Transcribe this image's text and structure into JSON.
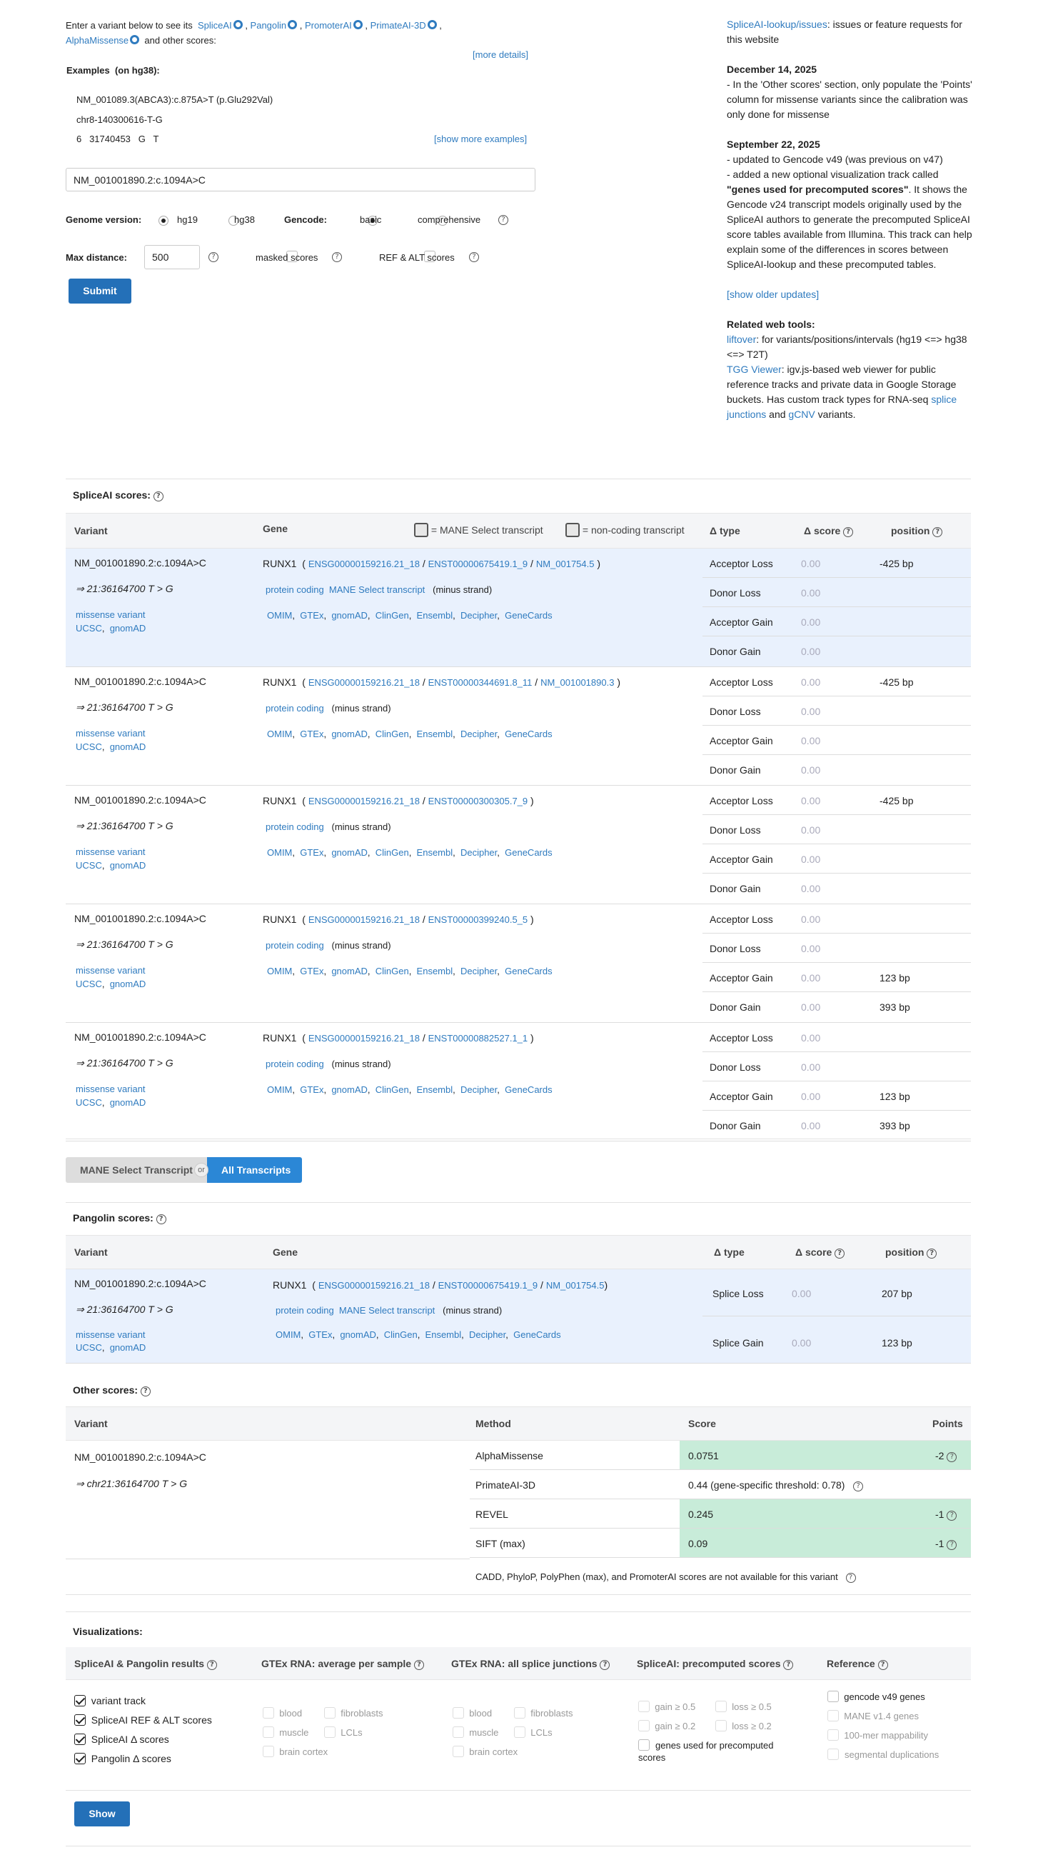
{
  "intro": {
    "text1": "Enter a variant below to see its",
    "tools": [
      "SpliceAI",
      "Pangolin",
      "PromoterAI",
      "PrimateAI-3D",
      "AlphaMissense"
    ],
    "text2": "and other scores:",
    "more_details": "[more details]",
    "examples_label": "Examples",
    "examples_genome": "(on hg38):",
    "examples": [
      "NM_001089.3(ABCA3):c.875A>T (p.Glu292Val)",
      "chr8-140300616-T-G",
      "6   31740453   G   T"
    ],
    "show_more": "[show more examples]",
    "input_value": "NM_001001890.2:c.1094A>C",
    "genome_label": "Genome version:",
    "hg19": "hg19",
    "hg38": "hg38",
    "gencode_label": "Gencode:",
    "basic": "basic",
    "comprehensive": "comprehensive",
    "max_distance_label": "Max distance:",
    "max_distance_value": "500",
    "masked": "masked scores",
    "refalt": "REF & ALT scores",
    "submit": "Submit"
  },
  "news": {
    "issues_link": "SpliceAI-lookup/issues",
    "issues_text": ": issues or feature requests for this website",
    "date1": "December 14, 2025",
    "text1": "- In the 'Other scores' section, only populate the 'Points' column for missense variants since the calibration was only done for missense",
    "date2": "September 22, 2025",
    "text2a": "- updated to Gencode v49 (was previous on v47)",
    "text2b": "- added a new optional visualization track called",
    "text2c": "\"genes used for precomputed scores\"",
    "text2d": ". It shows the Gencode v24 transcript models originally used by the SpliceAI authors to generate the precomputed SpliceAI score tables available from Illumina. This track can help explain some of the differences in scores between SpliceAI-lookup and these precomputed tables.",
    "older": "[show older updates]",
    "related_title": "Related web tools:",
    "liftover": "liftover",
    "liftover_text": ": for variants/positions/intervals (hg19 <=> hg38 <=> T2T)",
    "tgg": "TGG Viewer",
    "tgg_text": ": igv.js-based web viewer for public reference tracks and private data in Google Storage buckets. Has custom track types for RNA-seq",
    "splice_junctions": "splice junctions",
    "and": "and",
    "gcnv": "gCNV",
    "variants": "variants."
  },
  "spliceai": {
    "title": "SpliceAI scores:",
    "headers": {
      "variant": "Variant",
      "gene": "Gene",
      "mane": "= MANE Select transcript",
      "noncoding": "= non-coding transcript",
      "dtype": "Δ type",
      "dscore": "Δ score",
      "position": "position"
    },
    "variant": "NM_001001890.2:c.1094A>C",
    "coord": "⇒ 21:36164700 T > G",
    "consequence": "missense variant",
    "ucsc": "UCSC",
    "gnomad": "gnomAD",
    "gene": "RUNX1",
    "strand": "(minus strand)",
    "protein_coding": "protein coding",
    "mane_select": "MANE Select transcript",
    "links": [
      "OMIM",
      "GTEx",
      "gnomAD",
      "ClinGen",
      "Ensembl",
      "Decipher",
      "GeneCards"
    ],
    "dtypes": [
      "Acceptor Loss",
      "Donor Loss",
      "Acceptor Gain",
      "Donor Gain"
    ],
    "rows": [
      {
        "ensg": "ENSG00000159216.21_18",
        "enst": "ENST00000675419.1_9",
        "nm": "NM_001754.5",
        "mane": true,
        "scores": [
          "0.00",
          "0.00",
          "0.00",
          "0.00"
        ],
        "positions": [
          "-425 bp",
          "",
          "",
          ""
        ]
      },
      {
        "ensg": "ENSG00000159216.21_18",
        "enst": "ENST00000344691.8_11",
        "nm": "NM_001001890.3",
        "mane": false,
        "scores": [
          "0.00",
          "0.00",
          "0.00",
          "0.00"
        ],
        "positions": [
          "-425 bp",
          "",
          "",
          ""
        ]
      },
      {
        "ensg": "ENSG00000159216.21_18",
        "enst": "ENST00000300305.7_9",
        "nm": "",
        "mane": false,
        "scores": [
          "0.00",
          "0.00",
          "0.00",
          "0.00"
        ],
        "positions": [
          "-425 bp",
          "",
          "",
          ""
        ]
      },
      {
        "ensg": "ENSG00000159216.21_18",
        "enst": "ENST00000399240.5_5",
        "nm": "",
        "mane": false,
        "scores": [
          "0.00",
          "0.00",
          "0.00",
          "0.00"
        ],
        "positions": [
          "",
          "",
          "123 bp",
          "393 bp"
        ]
      },
      {
        "ensg": "ENSG00000159216.21_18",
        "enst": "ENST00000882527.1_1",
        "nm": "",
        "mane": false,
        "scores": [
          "0.00",
          "0.00",
          "0.00",
          "0.00"
        ],
        "positions": [
          "",
          "",
          "123 bp",
          "393 bp"
        ]
      }
    ]
  },
  "toggle": {
    "mane": "MANE Select Transcript",
    "or": "or",
    "all": "All Transcripts"
  },
  "pangolin": {
    "title": "Pangolin scores:",
    "headers": {
      "variant": "Variant",
      "gene": "Gene",
      "dtype": "Δ type",
      "dscore": "Δ score",
      "position": "position"
    },
    "ensg": "ENSG00000159216.21_18",
    "enst": "ENST00000675419.1_9",
    "nm": "NM_001754.5",
    "dtypes": [
      "Splice Loss",
      "Splice Gain"
    ],
    "scores": [
      "0.00",
      "0.00"
    ],
    "positions": [
      "207 bp",
      "123 bp"
    ]
  },
  "other": {
    "title": "Other scores:",
    "headers": {
      "variant": "Variant",
      "method": "Method",
      "score": "Score",
      "points": "Points"
    },
    "variant": "NM_001001890.2:c.1094A>C",
    "coord": "⇒ chr21:36164700 T > G",
    "rows": [
      {
        "method": "AlphaMissense",
        "score": "0.0751",
        "points": "-2",
        "green": true
      },
      {
        "method": "PrimateAI-3D",
        "score": "0.44  (gene-specific threshold: 0.78)",
        "points": "",
        "green": false
      },
      {
        "method": "REVEL",
        "score": "0.245",
        "points": "-1",
        "green": true
      },
      {
        "method": "SIFT (max)",
        "score": "0.09",
        "points": "-1",
        "green": true
      }
    ],
    "na_text": "CADD,  PhyloP,  PolyPhen (max),  and PromoterAI scores are not available for this variant"
  },
  "viz": {
    "title": "Visualizations:",
    "col_headers": [
      "SpliceAI & Pangolin results",
      "GTEx RNA: average per sample",
      "GTEx RNA: all splice junctions",
      "SpliceAI: precomputed scores",
      "Reference"
    ],
    "results": [
      "variant track",
      "SpliceAI REF & ALT scores",
      "SpliceAI Δ scores",
      "Pangolin Δ  scores"
    ],
    "tissues": [
      "blood",
      "fibroblasts",
      "muscle",
      "LCLs",
      "brain cortex"
    ],
    "precomputed": [
      "gain ≥ 0.5",
      "loss ≥ 0.5",
      "gain ≥ 0.2",
      "loss ≥ 0.2"
    ],
    "genes_precomputed": "genes used for precomputed scores",
    "reference": [
      "gencode v49 genes",
      "MANE v1.4 genes",
      "100-mer mappability",
      "segmental duplications"
    ],
    "show": "Show"
  }
}
